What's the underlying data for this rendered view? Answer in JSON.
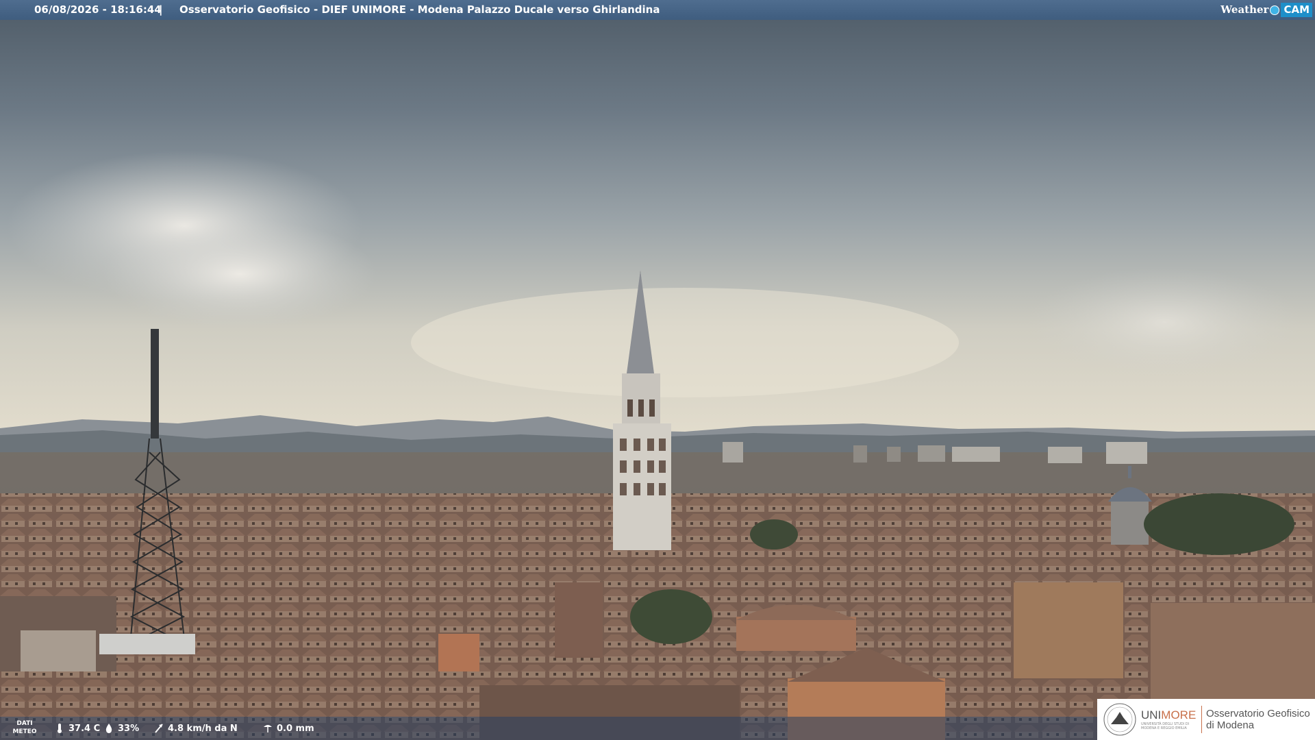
{
  "header": {
    "timestamp": "06/08/2026 - 18:16:44",
    "separator": "|",
    "title": "Osservatorio Geofisico - DIEF UNIMORE - Modena Palazzo Ducale verso Ghirlandina",
    "brand_weather": "Weather",
    "brand_cam": "CAM"
  },
  "weather": {
    "label_line1": "DATI",
    "label_line2": "METEO",
    "temperature": "37.4 C",
    "humidity": "33%",
    "wind": "4.8 km/h da N",
    "rain": "0.0 mm",
    "icons": [
      "thermometer-icon",
      "humidity-drop-icon",
      "wind-vane-icon",
      "rain-gauge-icon"
    ]
  },
  "logo": {
    "uni_prefix": "UNI",
    "uni_suffix": "MORE",
    "uni_sub1": "UNIVERSITÀ DEGLI STUDI DI",
    "uni_sub2": "MODENA E REGGIO EMILIA",
    "obs_line1": "Osservatorio Geofisico",
    "obs_line2": "di Modena"
  },
  "colors": {
    "topbar": "#4f6d8f",
    "brand_accent": "#1e8fc9",
    "logo_accent": "#c8704a"
  }
}
